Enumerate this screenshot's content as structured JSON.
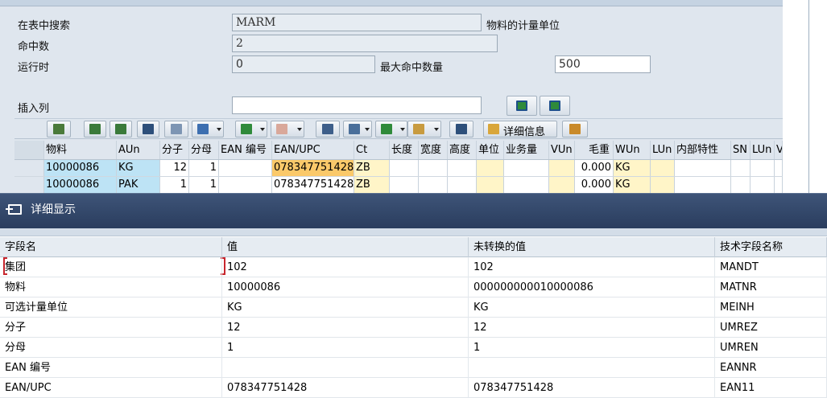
{
  "selection": {
    "search_label": "在表中搜索",
    "search_value": "MARM",
    "search_desc": "物料的计量单位",
    "hits_label": "命中数",
    "hits_value": "2",
    "runtime_label": "运行时",
    "runtime_value": "0",
    "max_hits_label": "最大命中数量",
    "max_hits_value": "500",
    "insert_col_label": "插入列",
    "insert_col_value": ""
  },
  "toolbar": {
    "detail_label": "详细信息"
  },
  "grid": {
    "headers": [
      "物料",
      "AUn",
      "分子",
      "分母",
      "EAN 编号",
      "EAN/UPC",
      "Ct",
      "长度",
      "宽度",
      "高度",
      "单位",
      "业务量",
      "VUn",
      "毛重",
      "WUn",
      "LUn",
      "内部特性",
      "SN",
      "LUn",
      "V"
    ],
    "rows": [
      [
        "10000086",
        "KG",
        "12",
        "1",
        "",
        "078347751428",
        "ZB",
        "",
        "",
        "",
        "",
        "",
        "",
        "0.000",
        "KG",
        "",
        "",
        "",
        "",
        ""
      ],
      [
        "10000086",
        "PAK",
        "1",
        "1",
        "",
        "078347751428",
        "ZB",
        "",
        "",
        "",
        "",
        "",
        "",
        "0.000",
        "KG",
        "",
        "",
        "",
        "",
        ""
      ]
    ]
  },
  "dialog": {
    "title": "详细显示",
    "headers": [
      "字段名",
      "值",
      "未转换的值",
      "技术字段名称"
    ],
    "rows": [
      [
        "集团",
        "102",
        "102",
        "MANDT"
      ],
      [
        "物料",
        "10000086",
        "000000000010000086",
        "MATNR"
      ],
      [
        "可选计量单位",
        "KG",
        "KG",
        "MEINH"
      ],
      [
        "分子",
        "12",
        "12",
        "UMREZ"
      ],
      [
        "分母",
        "1",
        "1",
        "UMREN"
      ],
      [
        "EAN 编号",
        "",
        "",
        "EANNR"
      ],
      [
        "EAN/UPC",
        "078347751428",
        "078347751428",
        "EAN11"
      ]
    ]
  }
}
